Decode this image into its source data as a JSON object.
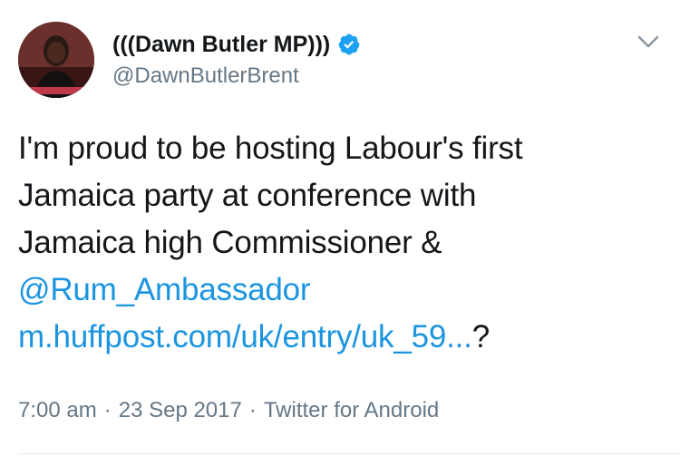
{
  "author": {
    "display_name": "(((Dawn Butler MP)))",
    "handle": "@DawnButlerBrent",
    "verified": true,
    "avatar_icon": "profile-photo"
  },
  "tweet": {
    "line1": "I'm proud to be hosting Labour's first",
    "line2": "Jamaica party at conference with",
    "line3": "Jamaica high Commissioner &",
    "mention": "@Rum_Ambassador",
    "link": "m.huffpost.com/uk/entry/uk_59...",
    "link_suffix": "?"
  },
  "meta": {
    "time": "7:00 am",
    "separator": "·",
    "date": "23 Sep 2017",
    "source": "Twitter for Android"
  },
  "colors": {
    "link": "#1b95e0",
    "verified": "#1da1f2",
    "secondary_text": "#657786"
  }
}
